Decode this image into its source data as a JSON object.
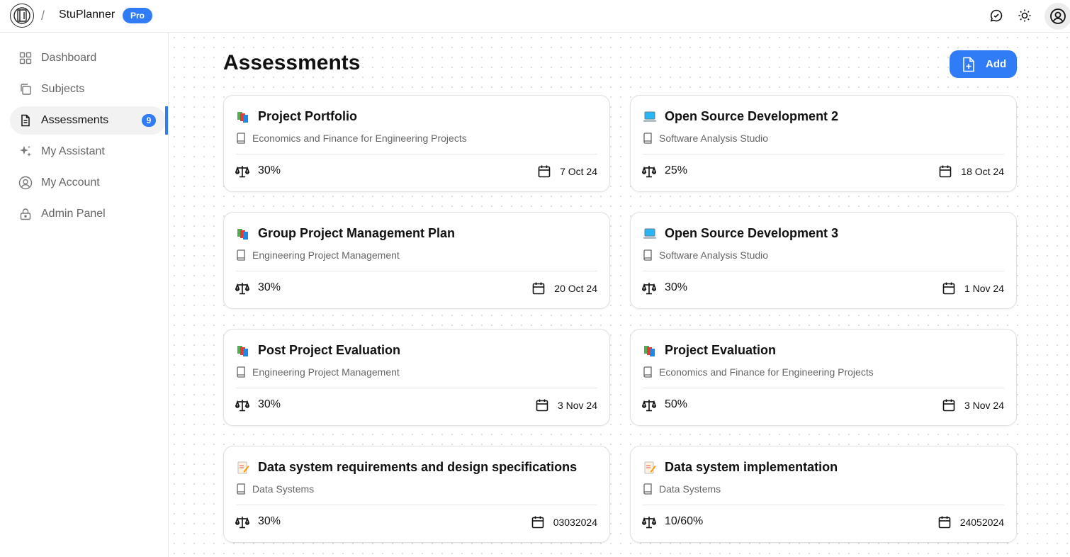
{
  "header": {
    "app_name": "StuPlanner",
    "badge": "Pro",
    "separator": "/"
  },
  "sidebar": {
    "items": [
      {
        "label": "Dashboard",
        "icon": "dashboard-grid-icon"
      },
      {
        "label": "Subjects",
        "icon": "subjects-copy-icon"
      },
      {
        "label": "Assessments",
        "icon": "document-icon",
        "count": "9",
        "active": true
      },
      {
        "label": "My Assistant",
        "icon": "sparkle-icon"
      },
      {
        "label": "My Account",
        "icon": "user-circle-icon"
      },
      {
        "label": "Admin Panel",
        "icon": "lock-icon"
      }
    ]
  },
  "main": {
    "title": "Assessments",
    "add_label": "Add",
    "cards": [
      {
        "emoji": "books-emoji-icon",
        "title": "Project Portfolio",
        "subject": "Economics and Finance for Engineering Projects",
        "weight": "30%",
        "date": "7 Oct 24"
      },
      {
        "emoji": "laptop-emoji-icon",
        "title": "Open Source Development 2",
        "subject": "Software Analysis Studio",
        "weight": "25%",
        "date": "18 Oct 24"
      },
      {
        "emoji": "books-emoji-icon",
        "title": "Group Project Management Plan",
        "subject": "Engineering Project Management",
        "weight": "30%",
        "date": "20 Oct 24"
      },
      {
        "emoji": "laptop-emoji-icon",
        "title": "Open Source Development 3",
        "subject": "Software Analysis Studio",
        "weight": "30%",
        "date": "1 Nov 24"
      },
      {
        "emoji": "books-emoji-icon",
        "title": "Post Project Evaluation",
        "subject": "Engineering Project Management",
        "weight": "30%",
        "date": "3 Nov 24"
      },
      {
        "emoji": "books-emoji-icon",
        "title": "Project Evaluation",
        "subject": "Economics and Finance for Engineering Projects",
        "weight": "50%",
        "date": "3 Nov 24"
      },
      {
        "emoji": "memo-emoji-icon",
        "title": "Data system requirements and design specifications",
        "subject": "Data Systems",
        "weight": "30%",
        "date": "03032024"
      },
      {
        "emoji": "memo-emoji-icon",
        "title": "Data system implementation",
        "subject": "Data Systems",
        "weight": "10/60%",
        "date": "24052024"
      }
    ]
  },
  "colors": {
    "accent": "#2f7cf6",
    "text": "#111111",
    "muted": "#666666",
    "border": "#e0e0e0"
  }
}
